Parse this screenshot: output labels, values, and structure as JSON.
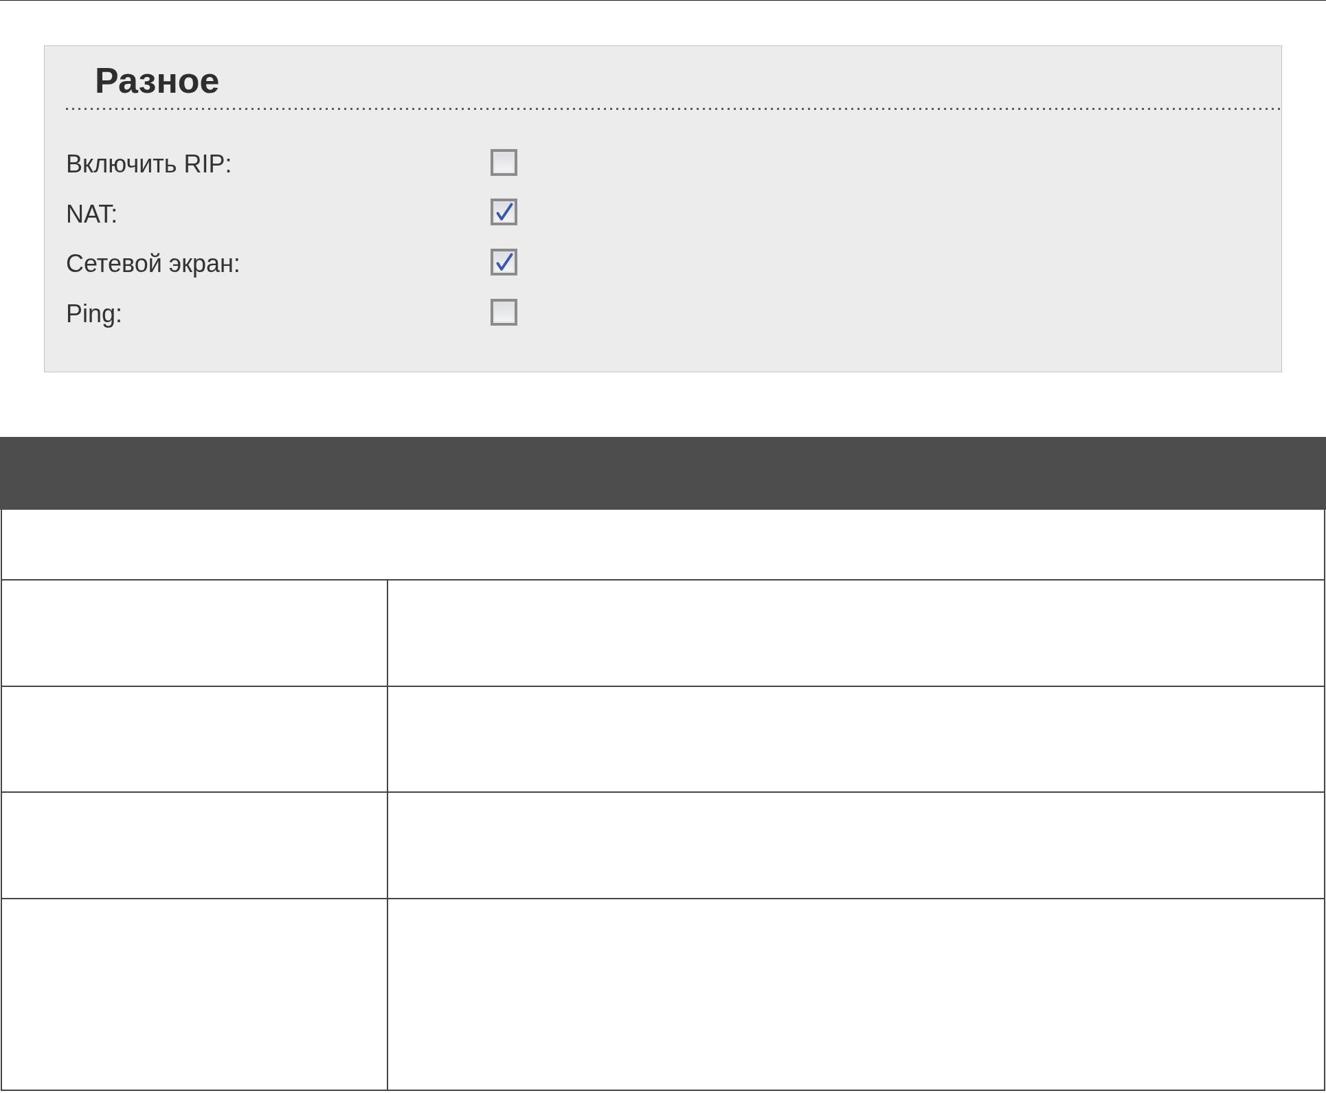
{
  "panel": {
    "title": "Разное",
    "options": [
      {
        "label": "Включить RIP:",
        "checked": false
      },
      {
        "label": "NAT:",
        "checked": true
      },
      {
        "label": "Сетевой экран:",
        "checked": true
      },
      {
        "label": "Ping:",
        "checked": false
      }
    ]
  }
}
